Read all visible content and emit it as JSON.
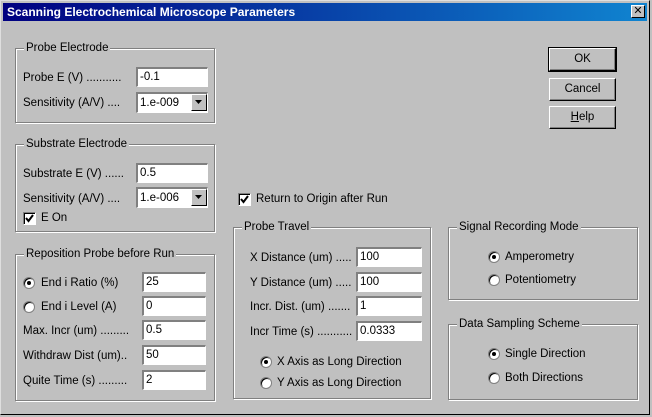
{
  "window": {
    "title": "Scanning Electrochemical Microscope Parameters",
    "close_glyph": "✕"
  },
  "buttons": {
    "ok": "OK",
    "cancel": "Cancel",
    "help_underlined": "H",
    "help_rest": "elp"
  },
  "probe_electrode": {
    "legend": "Probe Electrode",
    "probe_e_label": "Probe E (V) ...........",
    "probe_e_value": "-0.1",
    "sensitivity_label": "Sensitivity (A/V) ....",
    "sensitivity_value": "1.e-009"
  },
  "substrate_electrode": {
    "legend": "Substrate Electrode",
    "substrate_e_label": "Substrate E (V) ......",
    "substrate_e_value": "0.5",
    "sensitivity_label": "Sensitivity (A/V) ....",
    "sensitivity_value": "1.e-006",
    "e_on_label": "E On",
    "e_on_checked": true
  },
  "reposition": {
    "legend": "Reposition Probe before Run",
    "end_i_ratio_label": "End i Ratio (%)",
    "end_i_ratio_value": "25",
    "end_i_ratio_selected": true,
    "end_i_level_label": "End i Level (A)",
    "end_i_level_value": "0",
    "max_incr_label": "Max. Incr (um) .........",
    "max_incr_value": "0.5",
    "withdraw_label": "Withdraw Dist (um)..",
    "withdraw_value": "50",
    "quite_time_label": "Quite Time (s) .........",
    "quite_time_value": "2"
  },
  "return_to_origin": {
    "label": "Return to Origin after Run",
    "checked": true
  },
  "probe_travel": {
    "legend": "Probe Travel",
    "x_distance_label": "X Distance (um) .....",
    "x_distance_value": "100",
    "y_distance_label": "Y Distance (um) .....",
    "y_distance_value": "100",
    "incr_dist_label": "Incr. Dist. (um) .......",
    "incr_dist_value": "1",
    "incr_time_label": "Incr Time (s) ...........",
    "incr_time_value": "0.0333",
    "x_long_label": "X Axis as Long Direction",
    "y_long_label": "Y Axis as Long Direction",
    "x_long_selected": true
  },
  "signal_recording": {
    "legend": "Signal Recording Mode",
    "amperometry_label": "Amperometry",
    "potentiometry_label": "Potentiometry",
    "amperometry_selected": true
  },
  "data_sampling": {
    "legend": "Data Sampling Scheme",
    "single_label": "Single Direction",
    "both_label": "Both Directions",
    "single_selected": true
  }
}
